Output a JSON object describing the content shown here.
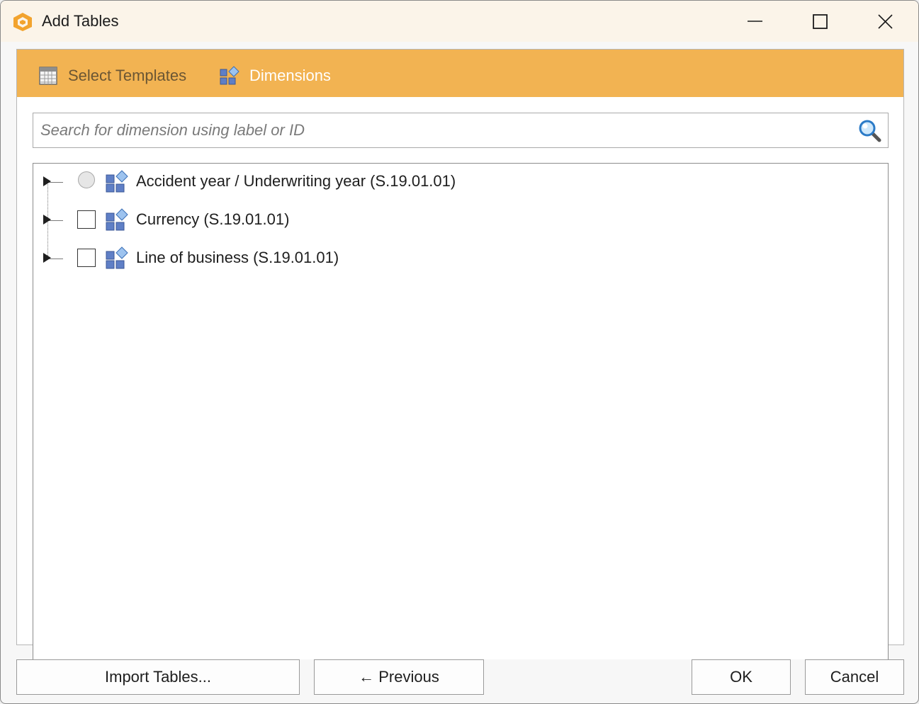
{
  "window": {
    "title": "Add Tables",
    "accent_color": "#f2b352"
  },
  "tabs": [
    {
      "label": "Select Templates",
      "icon": "table-grid-icon",
      "active": false
    },
    {
      "label": "Dimensions",
      "icon": "dimension-icon",
      "active": true
    }
  ],
  "search": {
    "placeholder": "Search for dimension using label or ID",
    "value": ""
  },
  "tree": {
    "items": [
      {
        "label": "Accident year / Underwriting year (S.19.01.01)",
        "selector": "radio",
        "expanded": false
      },
      {
        "label": "Currency (S.19.01.01)",
        "selector": "checkbox",
        "checked": false,
        "expanded": false
      },
      {
        "label": "Line of business (S.19.01.01)",
        "selector": "checkbox",
        "checked": false,
        "expanded": false
      }
    ]
  },
  "buttons": {
    "import": "Import Tables...",
    "previous": "← Previous",
    "ok": "OK",
    "cancel": "Cancel"
  }
}
